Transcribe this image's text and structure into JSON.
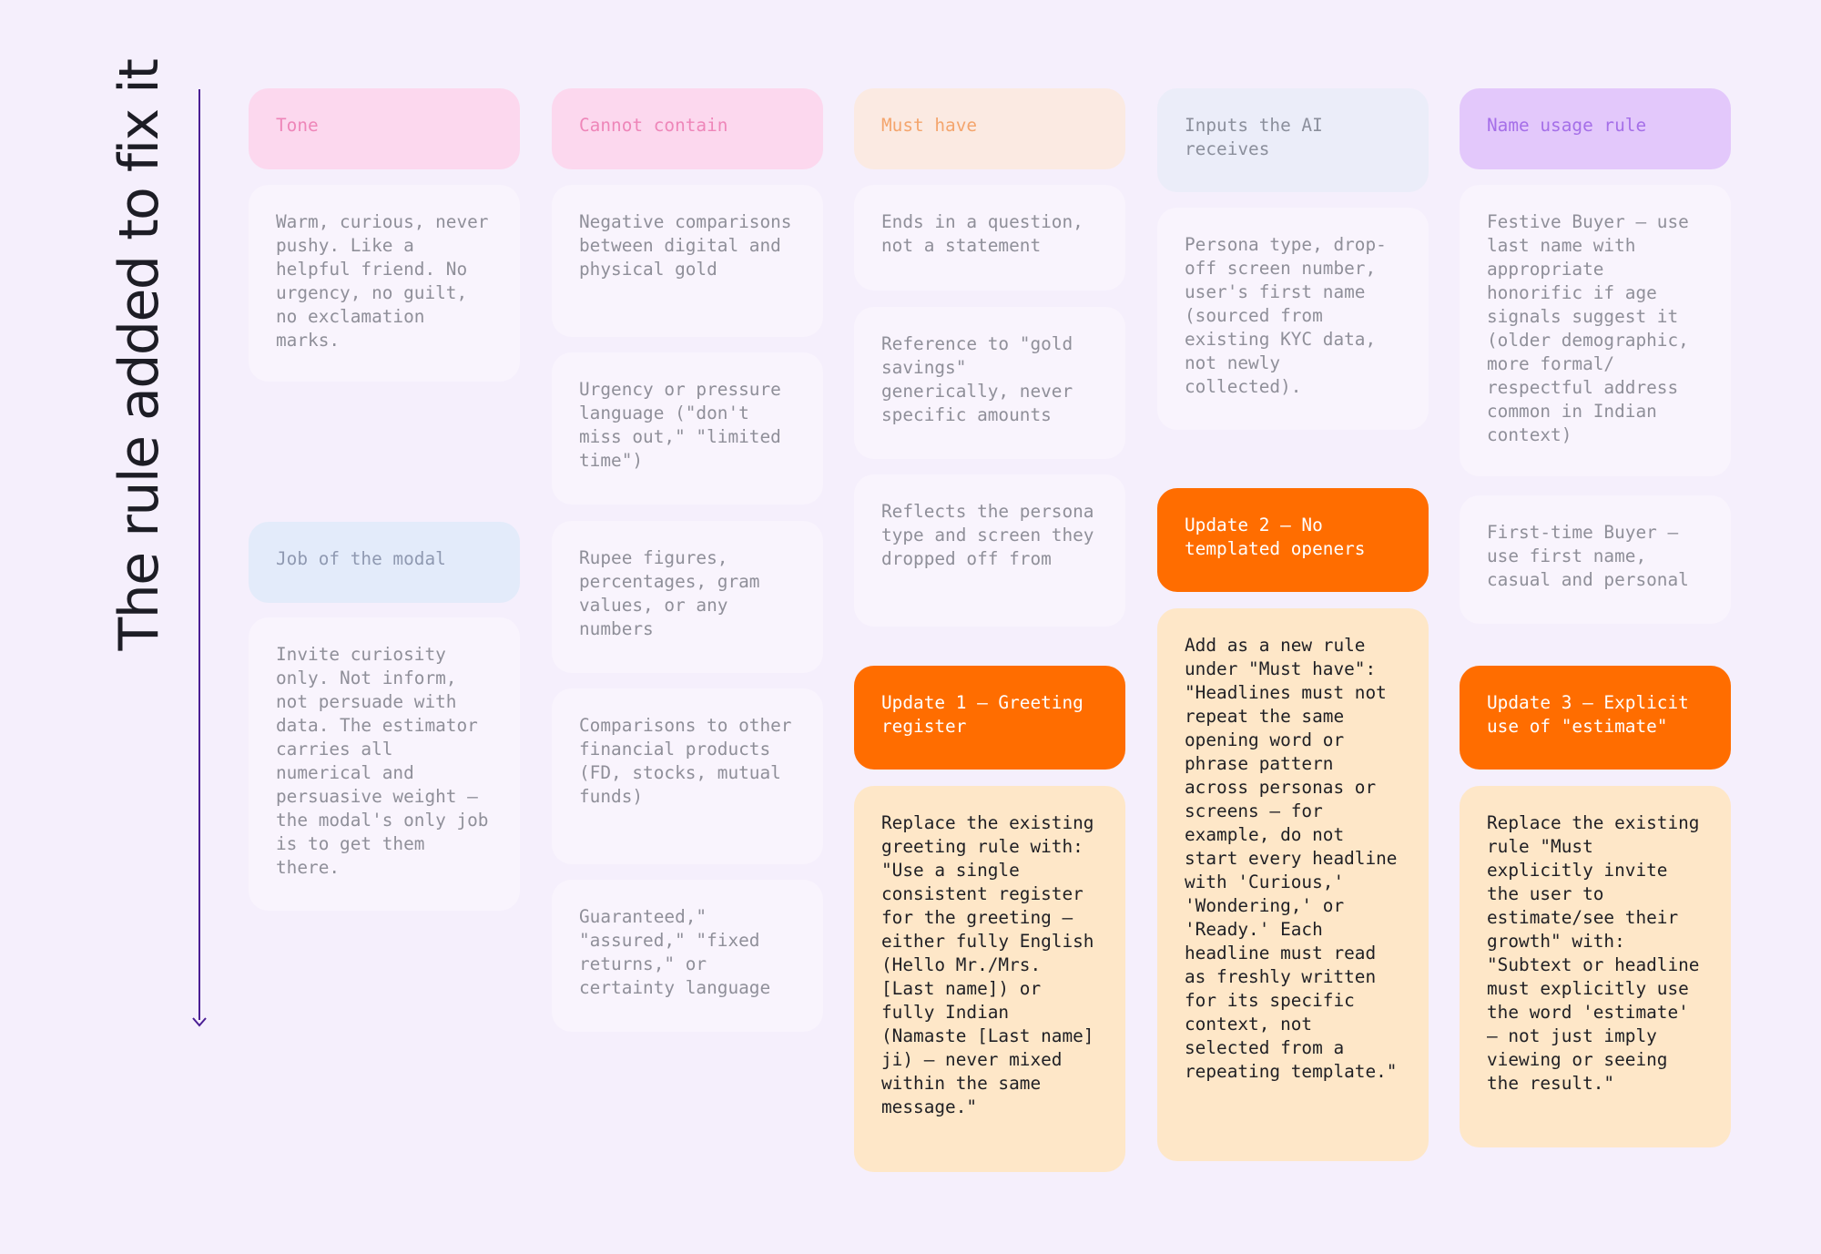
{
  "side_title": "The rule added to fix it",
  "columns": [
    {
      "header": "Tone",
      "items": [
        "Warm, curious, never pushy. Like a helpful friend. No urgency, no guilt, no exclamation marks."
      ],
      "second_header": "Job of the modal",
      "second_items": [
        "Invite curiosity only. Not inform, not persuade with data. The estimator carries all numerical and persuasive weight — the modal's only job is to get them there."
      ]
    },
    {
      "header": "Cannot contain",
      "items": [
        "Negative comparisons between digital and physical gold",
        "Urgency or pressure language (\"don't miss out,\" \"limited time\")",
        "Rupee figures, percentages, gram values, or any numbers",
        "Comparisons to other financial products (FD, stocks, mutual funds)",
        "Guaranteed,\" \"assured,\" \"fixed returns,\" or certainty language"
      ]
    },
    {
      "header": "Must have",
      "items": [
        "Ends in a question, not a statement",
        "Reference to \"gold savings\" generically, never specific amounts",
        "Reflects the persona type and screen they dropped off from"
      ],
      "update_title": "Update 1 — Greeting register",
      "update_body": "Replace the existing greeting rule with: \"Use a single consistent register for the greeting — either fully English (Hello Mr./Mrs. [Last name]) or fully Indian (Namaste [Last name] ji) — never mixed within the same message.\""
    },
    {
      "header": "Inputs the AI receives",
      "items": [
        "Persona type, drop-off screen number, user's first name (sourced from existing KYC data, not newly collected)."
      ],
      "update_title": "Update 2 — No templated openers",
      "update_body": "Add as a new rule under \"Must have\": \"Headlines must not repeat the same opening word or phrase pattern across personas or screens — for example, do not start every headline with 'Curious,' 'Wondering,' or 'Ready.' Each headline must read as freshly written for its specific context, not selected from a repeating template.\""
    },
    {
      "header": "Name usage rule",
      "items": [
        "Festive Buyer — use last name with appropriate honorific if age signals suggest it (older demographic, more formal/ respectful address common in Indian context)",
        "First-time Buyer — use first name, casual and personal"
      ],
      "update_title": "Update 3 — Explicit use of \"estimate\"",
      "update_body": "Replace the existing rule \"Must explicitly invite the user to estimate/see their growth\" with: \"Subtext or headline must explicitly use the word 'estimate' — not just imply viewing or seeing the result.\""
    }
  ],
  "colors": {
    "background": "#f5effc",
    "update_accent": "#ff6d00",
    "update_body": "#fee7c8",
    "arrow": "#4a1e94"
  }
}
